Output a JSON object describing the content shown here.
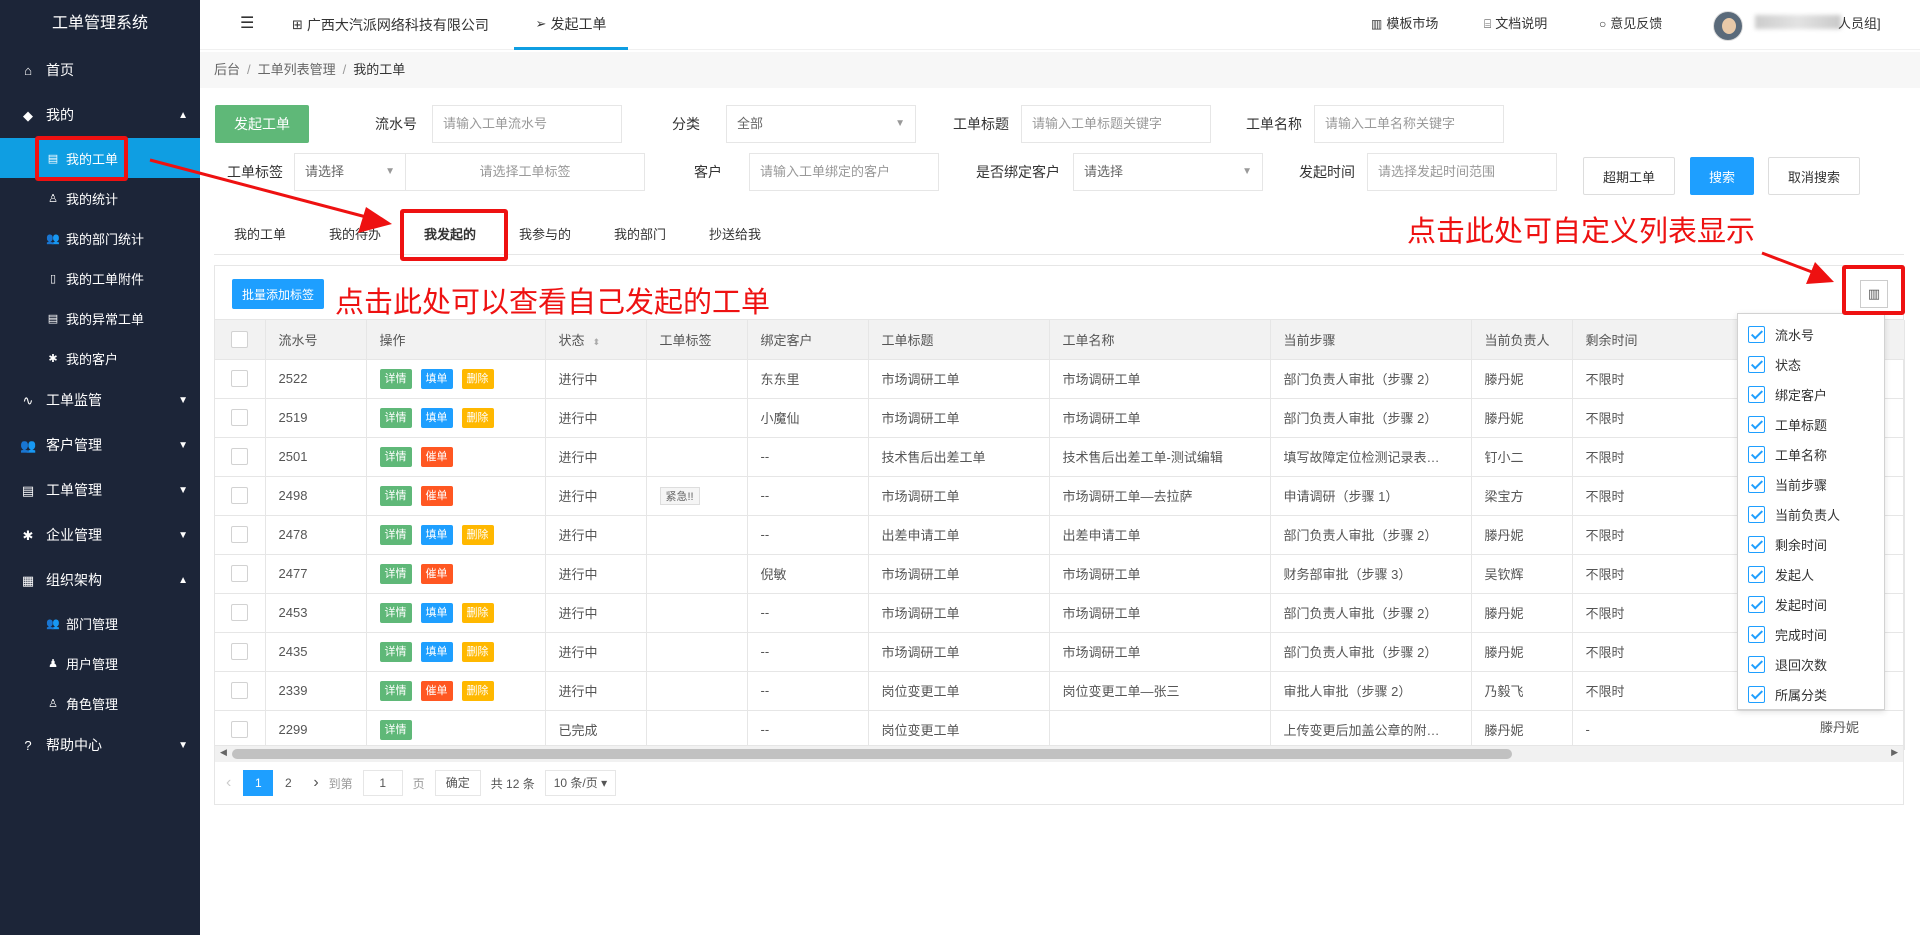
{
  "sidebar": {
    "title": "工单管理系统",
    "items": [
      {
        "label": "首页",
        "icon": "⌂"
      },
      {
        "label": "我的",
        "icon": "◆",
        "arrow": "▲"
      },
      {
        "label": "工单监管",
        "icon": "∿",
        "arrow": "▼"
      },
      {
        "label": "客户管理",
        "icon": "👥",
        "arrow": "▼"
      },
      {
        "label": "工单管理",
        "icon": "▤",
        "arrow": "▼"
      },
      {
        "label": "企业管理",
        "icon": "✱",
        "arrow": "▼"
      },
      {
        "label": "组织架构",
        "icon": "▦",
        "arrow": "▲"
      },
      {
        "label": "帮助中心",
        "icon": "?",
        "arrow": "▼"
      }
    ],
    "my_sub": [
      {
        "label": "我的工单",
        "icon": "▤"
      },
      {
        "label": "我的统计",
        "icon": "♙"
      },
      {
        "label": "我的部门统计",
        "icon": "👥"
      },
      {
        "label": "我的工单附件",
        "icon": "▯"
      },
      {
        "label": "我的异常工单",
        "icon": "▤"
      },
      {
        "label": "我的客户",
        "icon": "✱"
      }
    ],
    "org_sub": [
      {
        "label": "部门管理",
        "icon": "👥"
      },
      {
        "label": "用户管理",
        "icon": "♟"
      },
      {
        "label": "角色管理",
        "icon": "♙"
      }
    ]
  },
  "topbar": {
    "menu_icon": "☰",
    "company": "广西大汽派网络科技有限公司",
    "launch": "发起工单",
    "template_market": "模板市场",
    "docs": "文档说明",
    "feedback": "意见反馈",
    "user_suffix": "人员组]"
  },
  "breadcrumb": [
    "后台",
    "工单列表管理",
    "我的工单"
  ],
  "filters": {
    "launch_button": "发起工单",
    "serial_label": "流水号",
    "serial_placeholder": "请输入工单流水号",
    "category_label": "分类",
    "category_value": "全部",
    "title_label": "工单标题",
    "title_placeholder": "请输入工单标题关键字",
    "name_label": "工单名称",
    "name_placeholder": "请输入工单名称关键字",
    "tag_label": "工单标签",
    "tag_select": "请选择",
    "tag_placeholder": "请选择工单标签",
    "customer_label": "客户",
    "customer_placeholder": "请输入工单绑定的客户",
    "bind_label": "是否绑定客户",
    "bind_select": "请选择",
    "time_label": "发起时间",
    "time_placeholder": "请选择发起时间范围",
    "overdue_button": "超期工单",
    "search_button": "搜索",
    "cancel_button": "取消搜索"
  },
  "subtabs": [
    "我的工单",
    "我的待办",
    "我发起的",
    "我参与的",
    "我的部门",
    "抄送给我"
  ],
  "toolbar": {
    "batch_button": "批量添加标签",
    "col_icon": "▥"
  },
  "table": {
    "headers": [
      "流水号",
      "操作",
      "状态",
      "工单标签",
      "绑定客户",
      "工单标题",
      "工单名称",
      "当前步骤",
      "当前负责人",
      "剩余时间"
    ],
    "sort_icon": "⬍",
    "rows": [
      {
        "id": "2522",
        "ops": [
          "详情",
          "填单",
          "删除"
        ],
        "status": "进行中",
        "tag": "",
        "customer": "东东里",
        "title": "市场调研工单",
        "name": "市场调研工单",
        "step": "部门负责人审批（步骤 2）",
        "owner": "滕丹妮",
        "remain": "不限时"
      },
      {
        "id": "2519",
        "ops": [
          "详情",
          "填单",
          "删除"
        ],
        "status": "进行中",
        "tag": "",
        "customer": "小魔仙",
        "title": "市场调研工单",
        "name": "市场调研工单",
        "step": "部门负责人审批（步骤 2）",
        "owner": "滕丹妮",
        "remain": "不限时"
      },
      {
        "id": "2501",
        "ops": [
          "详情",
          "催单"
        ],
        "status": "进行中",
        "tag": "",
        "customer": "--",
        "title": "技术售后出差工单",
        "name": "技术售后出差工单-测试编辑",
        "step": "填写故障定位检测记录表…",
        "owner": "钉小二",
        "remain": "不限时"
      },
      {
        "id": "2498",
        "ops": [
          "详情",
          "催单"
        ],
        "status": "进行中",
        "tag": "紧急!!",
        "customer": "--",
        "title": "市场调研工单",
        "name": "市场调研工单—去拉萨",
        "step": "申请调研（步骤 1）",
        "owner": "梁宝方",
        "remain": "不限时"
      },
      {
        "id": "2478",
        "ops": [
          "详情",
          "填单",
          "删除"
        ],
        "status": "进行中",
        "tag": "",
        "customer": "--",
        "title": "出差申请工单",
        "name": "出差申请工单",
        "step": "部门负责人审批（步骤 2）",
        "owner": "滕丹妮",
        "remain": "不限时"
      },
      {
        "id": "2477",
        "ops": [
          "详情",
          "催单"
        ],
        "status": "进行中",
        "tag": "",
        "customer": "倪敏",
        "title": "市场调研工单",
        "name": "市场调研工单",
        "step": "财务部审批（步骤 3）",
        "owner": "吴钦辉",
        "remain": "不限时"
      },
      {
        "id": "2453",
        "ops": [
          "详情",
          "填单",
          "删除"
        ],
        "status": "进行中",
        "tag": "",
        "customer": "--",
        "title": "市场调研工单",
        "name": "市场调研工单",
        "step": "部门负责人审批（步骤 2）",
        "owner": "滕丹妮",
        "remain": "不限时"
      },
      {
        "id": "2435",
        "ops": [
          "详情",
          "填单",
          "删除"
        ],
        "status": "进行中",
        "tag": "",
        "customer": "--",
        "title": "市场调研工单",
        "name": "市场调研工单",
        "step": "部门负责人审批（步骤 2）",
        "owner": "滕丹妮",
        "remain": "不限时"
      },
      {
        "id": "2339",
        "ops": [
          "详情",
          "催单",
          "删除"
        ],
        "status": "进行中",
        "tag": "",
        "customer": "--",
        "title": "岗位变更工单",
        "name": "岗位变更工单—张三",
        "step": "审批人审批（步骤 2）",
        "owner": "乃毅飞",
        "remain": "不限时"
      },
      {
        "id": "2299",
        "ops": [
          "详情"
        ],
        "status": "已完成",
        "tag": "",
        "customer": "--",
        "title": "岗位变更工单",
        "name": "",
        "step": "上传变更后加盖公章的附…",
        "owner": "滕丹妮",
        "remain": "-"
      }
    ],
    "outside_cell": "滕丹妮"
  },
  "column_options": [
    "流水号",
    "状态",
    "绑定客户",
    "工单标题",
    "工单名称",
    "当前步骤",
    "当前负责人",
    "剩余时间",
    "发起人",
    "发起时间",
    "完成时间",
    "退回次数",
    "所属分类"
  ],
  "pagination": {
    "prev": "‹",
    "next": "›",
    "pages": [
      "1",
      "2"
    ],
    "goto_label": "到第",
    "page_value": "1",
    "page_unit": "页",
    "confirm": "确定",
    "total": "共 12 条",
    "size": "10 条/页"
  },
  "annotations": {
    "view_own": "点击此处可以查看自己发起的工单",
    "customize": "点击此处可自定义列表显示"
  },
  "colors": {
    "sidebar_bg": "#1c2538",
    "active_blue": "#0f9ee2",
    "primary": "#1e9fff",
    "green": "#5fb878",
    "annotation_red": "#ee1111"
  }
}
